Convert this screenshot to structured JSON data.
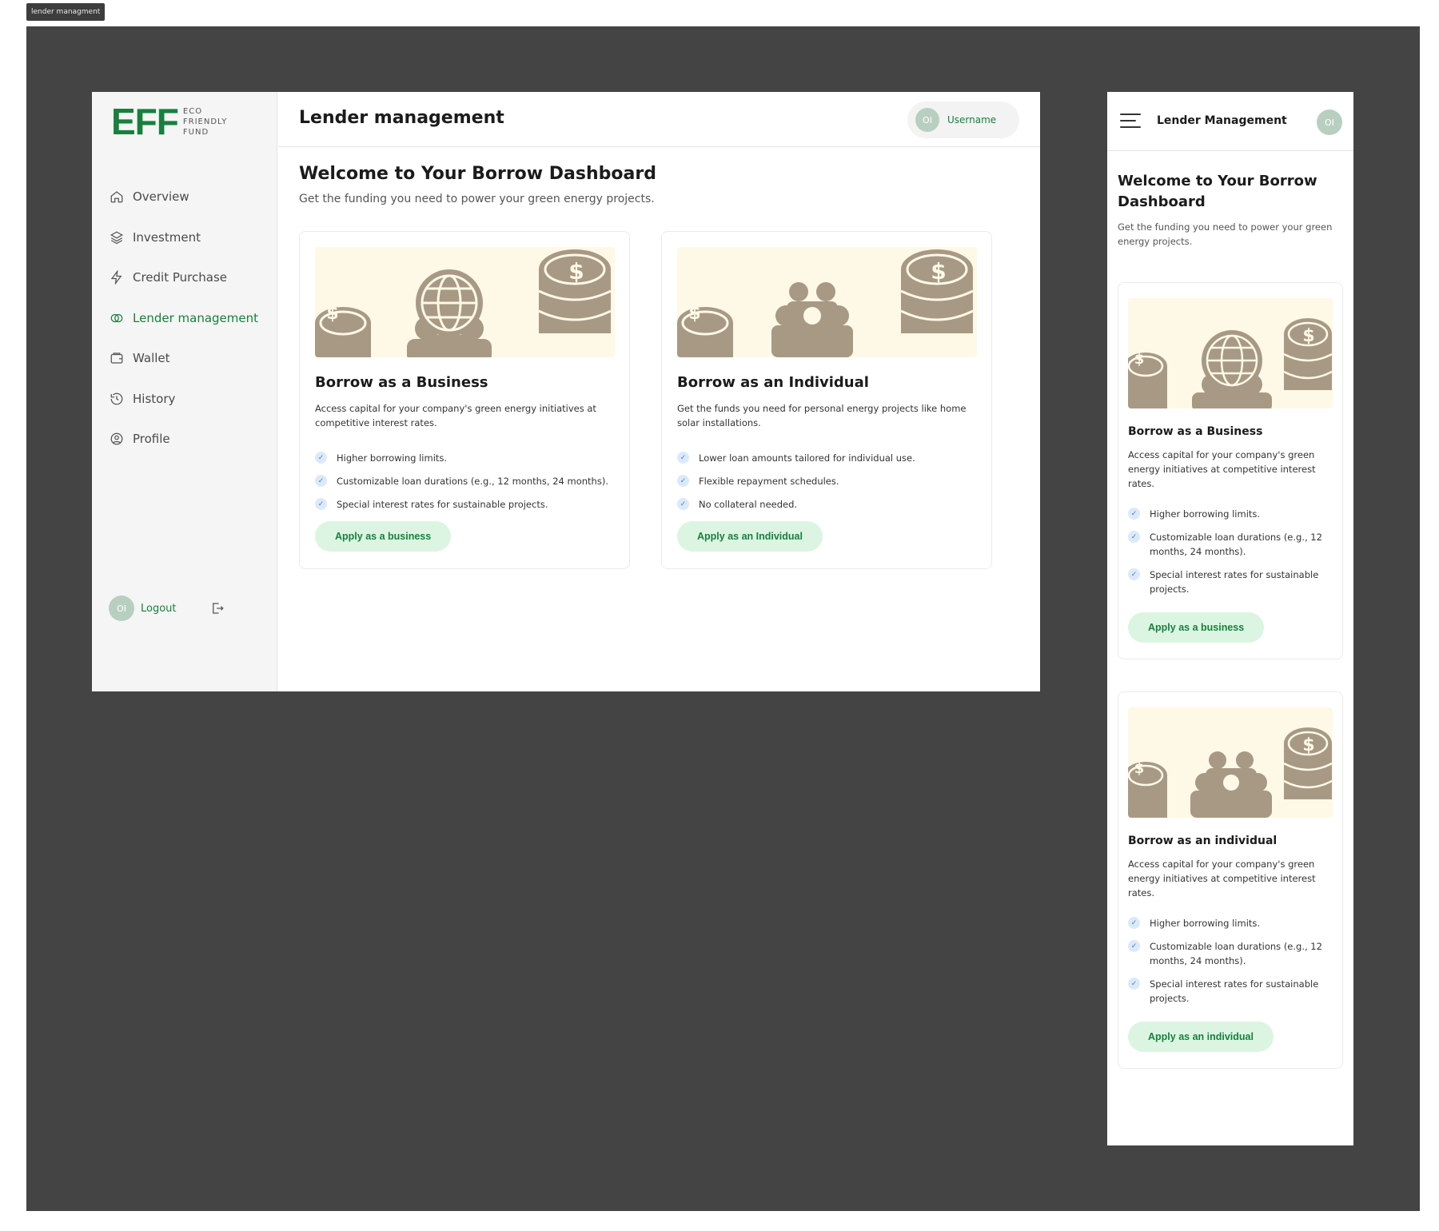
{
  "frame_tag": "lender managment",
  "brand": {
    "mark": "EFF",
    "line1": "ECO",
    "line2": "FRIENDLY",
    "line3": "FUND",
    "color": "#17803d"
  },
  "sidebar": {
    "items": [
      {
        "label": "Overview",
        "icon": "home-icon"
      },
      {
        "label": "Investment",
        "icon": "layers-icon"
      },
      {
        "label": "Credit Purchase",
        "icon": "lightning-icon"
      },
      {
        "label": "Lender management",
        "icon": "rings-icon",
        "active": true
      },
      {
        "label": "Wallet",
        "icon": "wallet-icon"
      },
      {
        "label": "History",
        "icon": "history-icon"
      },
      {
        "label": "Profile",
        "icon": "profile-icon"
      }
    ],
    "logout": {
      "initials": "OI",
      "label": "Logout"
    }
  },
  "header": {
    "title": "Lender management",
    "user": {
      "initials": "OI",
      "name": "Username"
    }
  },
  "main": {
    "welcome": "Welcome to Your Borrow Dashboard",
    "subtitle": "Get the funding you need to power your green energy projects.",
    "cards": [
      {
        "title": "Borrow as a Business",
        "desc": "Access capital for your company's green energy initiatives at competitive interest rates.",
        "features": [
          "Higher borrowing limits.",
          "Customizable loan durations (e.g., 12 months, 24 months).",
          "Special interest rates for sustainable projects."
        ],
        "button": "Apply as a business"
      },
      {
        "title": "Borrow as an Individual",
        "desc": "Get the funds you need for personal energy projects like home solar installations.",
        "features": [
          "Lower loan amounts tailored for individual use.",
          "Flexible repayment schedules.",
          "No collateral needed."
        ],
        "button": "Apply as an Individual"
      }
    ]
  },
  "mobile": {
    "title": "Lender Management",
    "avatar_initials": "OI",
    "welcome": "Welcome to Your Borrow Dashboard",
    "subtitle": "Get the funding you need to power your green energy projects.",
    "cards": [
      {
        "title": "Borrow as a Business",
        "desc": "Access capital for your company's green energy initiatives at competitive interest rates.",
        "features": [
          "Higher borrowing limits.",
          "Customizable loan durations (e.g., 12 months, 24 months).",
          "Special interest rates for sustainable projects."
        ],
        "button": "Apply as a business"
      },
      {
        "title": "Borrow as an individual",
        "desc": "Access capital for your company's green energy initiatives at competitive interest rates.",
        "features": [
          "Higher borrowing limits.",
          "Customizable loan durations (e.g., 12 months, 24 months).",
          "Special interest rates for sustainable projects."
        ],
        "button": "Apply as an individual"
      }
    ]
  },
  "colors": {
    "accent": "#17803d",
    "button_bg": "#dcf5e2",
    "illustration_bg": "#fdf9e6",
    "illustration_fg": "#a89985",
    "canvas": "#444444"
  }
}
